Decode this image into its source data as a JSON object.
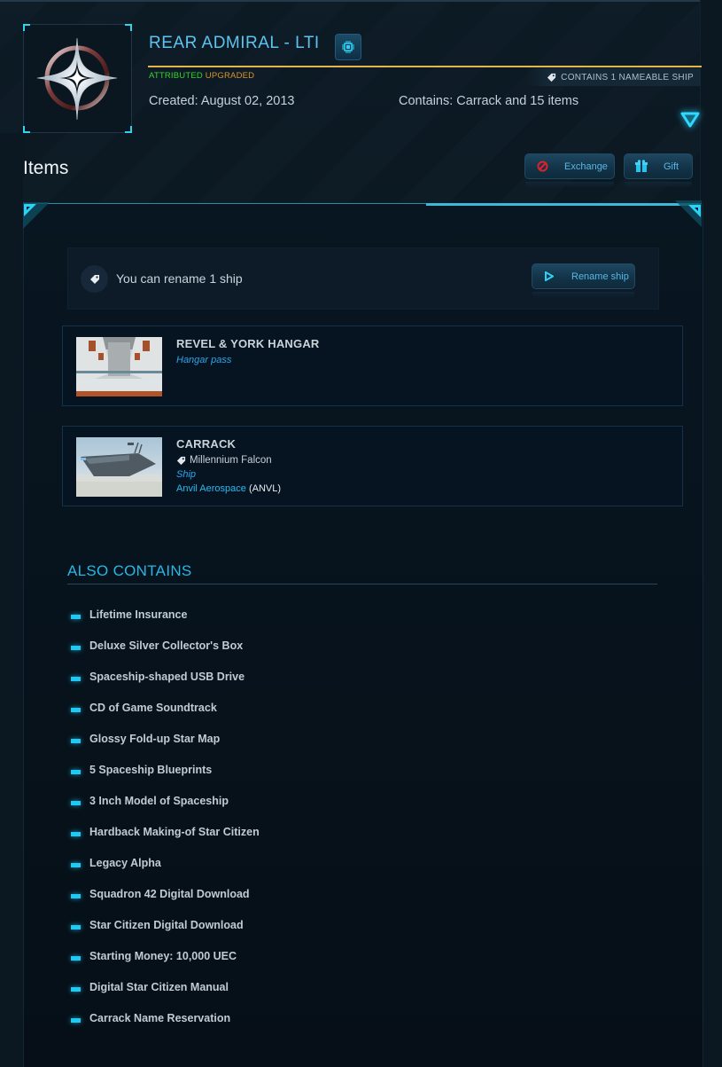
{
  "package": {
    "title": "REAR ADMIRAL - LTI",
    "chip_icon": "chip-icon",
    "badge_icon": "rank-star-badge-icon",
    "attributes": [
      {
        "label": "ATTRIBUTED",
        "color": "#38d32e"
      },
      {
        "label": "UPGRADED",
        "color": "#d9962b"
      }
    ],
    "nameable_badge": "CONTAINS 1 NAMEABLE SHIP",
    "created": "Created: August 02, 2013",
    "contains": "Contains: Carrack and 15 items",
    "expand_icon": "triangle-down-icon"
  },
  "items_section": {
    "title": "Items",
    "buttons": {
      "exchange": "Exchange",
      "gift": "Gift"
    }
  },
  "rename": {
    "text": "You can rename 1 ship",
    "button": "Rename ship"
  },
  "items": [
    {
      "name": "REVEL & YORK HANGAR",
      "type": "Hangar pass"
    },
    {
      "name": "CARRACK",
      "custom_name": "Millennium Falcon",
      "type": "Ship",
      "manufacturer": "Anvil Aerospace",
      "manufacturer_code": "(ANVL)"
    }
  ],
  "also_contains": {
    "title": "ALSO CONTAINS",
    "items": [
      "Lifetime Insurance",
      "Deluxe Silver Collector's Box",
      "Spaceship-shaped USB Drive",
      "CD of Game Soundtrack",
      "Glossy Fold-up Star Map",
      "5 Spaceship Blueprints",
      "3 Inch Model of Spaceship",
      "Hardback Making-of Star Citizen",
      "Legacy Alpha",
      "Squadron 42 Digital Download",
      "Star Citizen Digital Download",
      "Starting Money: 10,000 UEC",
      "Digital Star Citizen Manual",
      "Carrack Name Reservation"
    ]
  },
  "colors": {
    "accent": "#28b7e6",
    "title_blue": "#5ec3ee",
    "gold_divider": "#e3b54a",
    "exchange_icon": "#e0202a"
  }
}
